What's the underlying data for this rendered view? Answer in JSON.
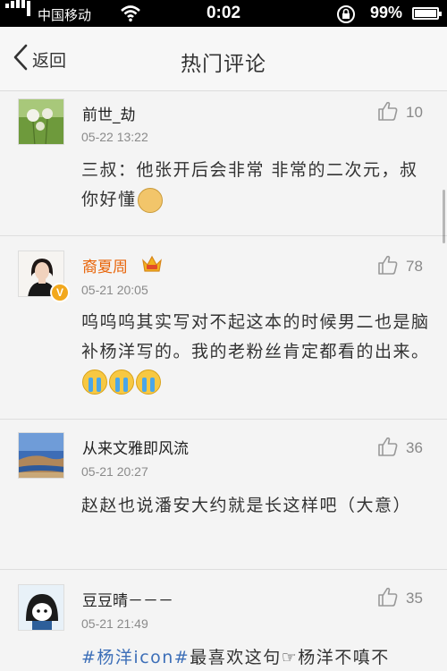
{
  "status_bar": {
    "carrier": "中国移动",
    "time": "0:02",
    "battery": "99%",
    "battery_level": 0.99
  },
  "nav": {
    "back_label": "返回",
    "title": "热门评论"
  },
  "comments": [
    {
      "username": "前世_劫",
      "time": "05-22 13:22",
      "likes": "10",
      "text": "三叔：他张开后会非常 非常的二次元，叔你好懂",
      "emoji": [
        "doge"
      ]
    },
    {
      "username": "裔夏周",
      "verified": true,
      "vip": true,
      "time": "05-21 20:05",
      "likes": "78",
      "text": "呜呜呜其实写对不起这本的时候男二也是脑补杨洋写的。我的老粉丝肯定都看的出来。",
      "emoji": [
        "cry",
        "cry",
        "cry"
      ]
    },
    {
      "username": "从来文雅即风流",
      "time": "05-21 20:27",
      "likes": "36",
      "text": "赵赵也说潘安大约就是长这样吧（大意）"
    },
    {
      "username": "豆豆晴－－－",
      "time": "05-21 21:49",
      "likes": "35",
      "hashtag": "#杨洋icon#",
      "text": "最喜欢这句☞杨洋不嗔不"
    }
  ],
  "colors": {
    "background": "#f4f4f4",
    "vip_name": "#e8650a",
    "verified_badge": "#f2a81d",
    "hashtag": "#3d6fb8"
  }
}
